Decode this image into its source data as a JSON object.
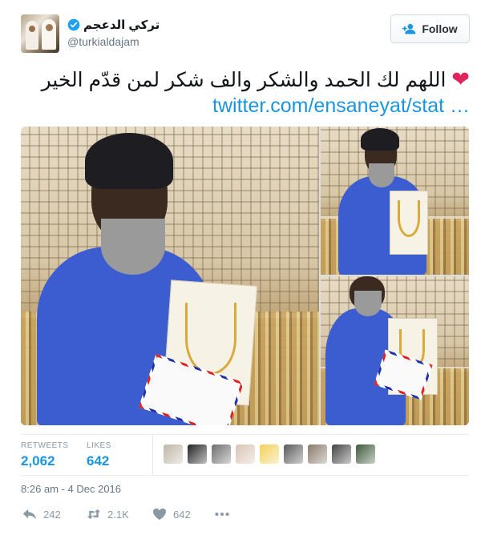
{
  "user": {
    "display_name": "تركي الدعجم",
    "handle": "@turkialdajam",
    "verified": true
  },
  "follow_button": {
    "label": "Follow"
  },
  "tweet": {
    "text": "اللهم لك الحمد والشكر والف شكر لمن قدّم الخير",
    "emoji": "❤",
    "link": "twitter.com/ensaneyat/stat …"
  },
  "stats": {
    "retweets_label": "RETWEETS",
    "retweets_value": "2,062",
    "likes_label": "LIKES",
    "likes_value": "642",
    "liker_avatar_colors": [
      "#bfb6a8",
      "#222222",
      "#6e6e6e",
      "#d9c4b6",
      "#f2d15a",
      "#5a5a5a",
      "#8a7a6a",
      "#444444",
      "#3e5a3a"
    ]
  },
  "timestamp": "8:26 am - 4 Dec 2016",
  "actions": {
    "reply_count": "242",
    "retweet_count": "2.1K",
    "like_count": "642"
  },
  "colors": {
    "link": "#1b95e0",
    "heart": "#e0245e",
    "verified": "#1da1f2",
    "muted": "#8899a6"
  },
  "icons": [
    "verified-badge-icon",
    "follow-person-icon",
    "reply-icon",
    "retweet-icon",
    "heart-icon",
    "more-dots-icon"
  ]
}
